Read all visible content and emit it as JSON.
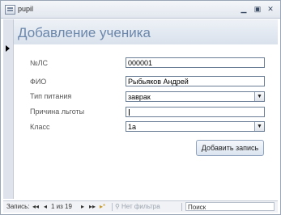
{
  "window": {
    "title": "pupil",
    "minimize_icon": "minimize-icon",
    "maximize_icon": "maximize-icon",
    "close_icon": "close-icon"
  },
  "form": {
    "title": "Добавление ученика",
    "fields": [
      {
        "label": "№ЛС",
        "value": "000001",
        "type": "text"
      },
      {
        "label": "ФИО",
        "value": "Рыбьяков Андрей",
        "type": "text"
      },
      {
        "label": "Тип питания",
        "value": "заврак",
        "type": "combo"
      },
      {
        "label": "Причина льготы",
        "value": "",
        "type": "text"
      },
      {
        "label": "Класс",
        "value": "1а",
        "type": "combo"
      }
    ],
    "add_button_label": "Добавить запись"
  },
  "navigation": {
    "record_label": "Запись:",
    "first_glyph": "◂◂",
    "prev_glyph": "◂",
    "position": "1 из 19",
    "next_glyph": "▸",
    "last_glyph": "▸▸",
    "new_glyph": "▸*",
    "filter_label": "Нет фильтра",
    "search_label": "Поиск"
  }
}
